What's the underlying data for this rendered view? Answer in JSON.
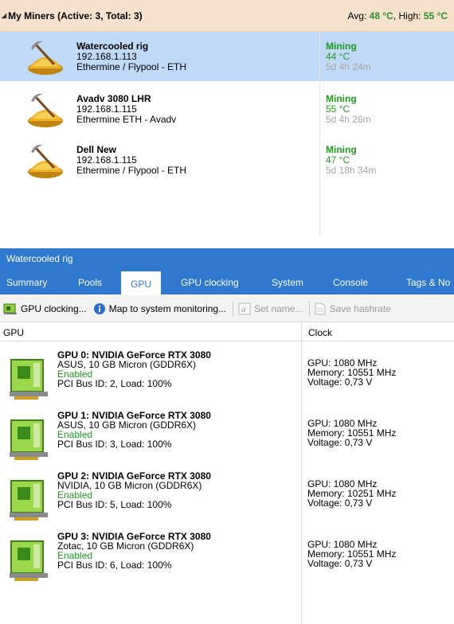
{
  "miners_group": {
    "title": "My Miners (Active: 3, Total: 3)",
    "avg_label": "Avg:",
    "avg_value": "48 °C",
    "high_label": ", High:",
    "high_value": "55 °C"
  },
  "miners": [
    {
      "name": "Watercooled rig",
      "ip": "192.168.1.113",
      "pool": "Ethermine / Flypool - ETH",
      "status": "Mining",
      "temp": "44 °C",
      "uptime": "5d 4h 24m",
      "selected": true
    },
    {
      "name": "Avadv 3080 LHR",
      "ip": "192.168.1.115",
      "pool": "Ethermine ETH - Avadv",
      "status": "Mining",
      "temp": "55 °C",
      "uptime": "5d 4h 26m",
      "selected": false
    },
    {
      "name": "Dell New",
      "ip": "192.168.1.115",
      "pool": "Ethermine / Flypool - ETH",
      "status": "Mining",
      "temp": "47 °C",
      "uptime": "5d 18h 34m",
      "selected": false
    }
  ],
  "detail": {
    "title": "Watercooled rig",
    "tabs": [
      "Summary",
      "Pools",
      "GPU",
      "GPU clocking",
      "System",
      "Console",
      "Tags & No"
    ],
    "active_tab": "GPU",
    "toolbar": {
      "gpu_clocking": "GPU clocking...",
      "map_monitoring": "Map to system monitoring...",
      "set_name": "Set name...",
      "save_hashrate": "Save hashrate"
    },
    "columns": {
      "gpu": "GPU",
      "clock": "Clock"
    }
  },
  "gpus": [
    {
      "title": "GPU 0: NVIDIA GeForce RTX 3080",
      "vendor": "ASUS, 10 GB Micron (GDDR6X)",
      "state": "Enabled",
      "bus": "PCI Bus ID: 2, Load: 100%",
      "clock_gpu": "GPU: 1080 MHz",
      "clock_mem": "Memory: 10551 MHz",
      "voltage": "Voltage: 0,73 V"
    },
    {
      "title": "GPU 1: NVIDIA GeForce RTX 3080",
      "vendor": "ASUS, 10 GB Micron (GDDR6X)",
      "state": "Enabled",
      "bus": "PCI Bus ID: 3, Load: 100%",
      "clock_gpu": "GPU: 1080 MHz",
      "clock_mem": "Memory: 10551 MHz",
      "voltage": "Voltage: 0,73 V"
    },
    {
      "title": "GPU 2: NVIDIA GeForce RTX 3080",
      "vendor": "NVIDIA, 10 GB Micron (GDDR6X)",
      "state": "Enabled",
      "bus": "PCI Bus ID: 5, Load: 100%",
      "clock_gpu": "GPU: 1080 MHz",
      "clock_mem": "Memory: 10251 MHz",
      "voltage": "Voltage: 0,73 V"
    },
    {
      "title": "GPU 3: NVIDIA GeForce RTX 3080",
      "vendor": "Zotac, 10 GB Micron (GDDR6X)",
      "state": "Enabled",
      "bus": "PCI Bus ID: 6, Load: 100%",
      "clock_gpu": "GPU: 1080 MHz",
      "clock_mem": "Memory: 10551 MHz",
      "voltage": "Voltage: 0,73 V"
    }
  ],
  "icons": {
    "group_expand": "collapse-triangle-icon",
    "miner": "pickaxe-gold-icon",
    "gpu": "graphics-card-icon",
    "toolbar_clocking": "gpu-clocking-icon",
    "toolbar_map": "info-icon",
    "toolbar_setname": "rename-icon",
    "toolbar_save": "document-icon"
  },
  "colors": {
    "group_header_bg": "#f6e2cc",
    "selected_row_bg": "#bfd9f7",
    "status_green": "#1c9a1c",
    "panel_blue": "#2f78d0",
    "uptime_gray": "#a5a5a5"
  }
}
